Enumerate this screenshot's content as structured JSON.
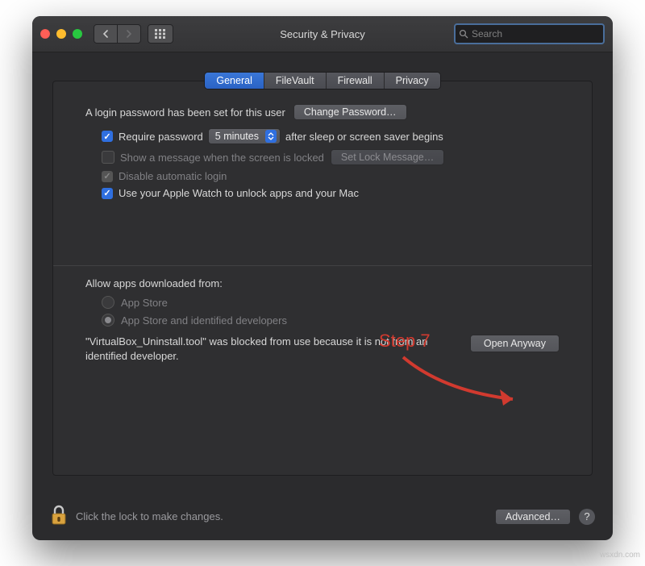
{
  "window": {
    "title": "Security & Privacy"
  },
  "search": {
    "placeholder": "Search"
  },
  "tabs": {
    "general": "General",
    "filevault": "FileVault",
    "firewall": "Firewall",
    "privacy": "Privacy"
  },
  "login": {
    "password_set_text": "A login password has been set for this user",
    "change_password_btn": "Change Password…",
    "require_password_label": "Require password",
    "delay_value": "5 minutes",
    "after_sleep_text": "after sleep or screen saver begins",
    "show_message_label": "Show a message when the screen is locked",
    "set_lock_message_btn": "Set Lock Message…",
    "disable_auto_login_label": "Disable automatic login",
    "apple_watch_label": "Use your Apple Watch to unlock apps and your Mac"
  },
  "downloads": {
    "heading": "Allow apps downloaded from:",
    "app_store": "App Store",
    "app_store_dev": "App Store and identified developers",
    "blocked_text": "\"VirtualBox_Uninstall.tool\" was blocked from use because it is not from an identified developer.",
    "open_anyway_btn": "Open Anyway"
  },
  "footer": {
    "lock_text": "Click the lock to make changes.",
    "advanced_btn": "Advanced…"
  },
  "annotation": {
    "label": "Step 7"
  },
  "watermark": "wsxdn.com"
}
